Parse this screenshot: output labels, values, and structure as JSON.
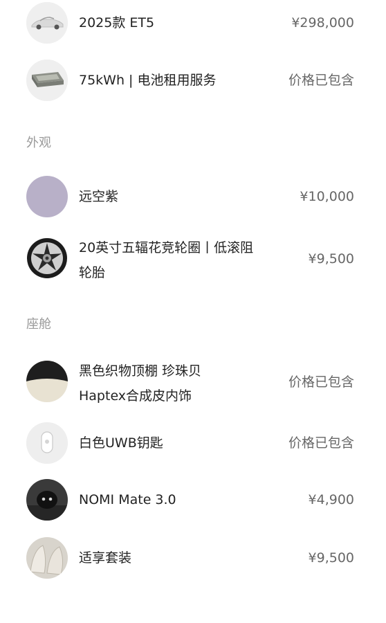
{
  "items_top": [
    {
      "icon": "car-icon",
      "name": "2025款 ET5",
      "price": "¥298,000"
    },
    {
      "icon": "battery-icon",
      "name": "75kWh | 电池租用服务",
      "price": "价格已包含"
    }
  ],
  "sections": [
    {
      "title": "外观",
      "items": [
        {
          "icon": "purple-color-swatch-icon",
          "name_lines": [
            "远空紫"
          ],
          "price": "¥10,000",
          "swatch_color": "#b8b0c8"
        },
        {
          "icon": "wheel-icon",
          "name_lines": [
            "20英寸五辐花竞轮圈丨低滚阻",
            "轮胎"
          ],
          "price": "¥9,500"
        }
      ]
    },
    {
      "title": "座舱",
      "items": [
        {
          "icon": "interior-swatch-icon",
          "name_lines": [
            "黑色织物顶棚 珍珠贝",
            "Haptex合成皮内饰"
          ],
          "price": "价格已包含"
        },
        {
          "icon": "uwb-key-icon",
          "name_lines": [
            "白色UWB钥匙"
          ],
          "price": "价格已包含"
        },
        {
          "icon": "nomi-robot-icon",
          "name_lines": [
            "NOMI Mate 3.0"
          ],
          "price": "¥4,900"
        },
        {
          "icon": "seat-package-icon",
          "name_lines": [
            "适享套装"
          ],
          "price": "¥9,500"
        }
      ]
    }
  ]
}
